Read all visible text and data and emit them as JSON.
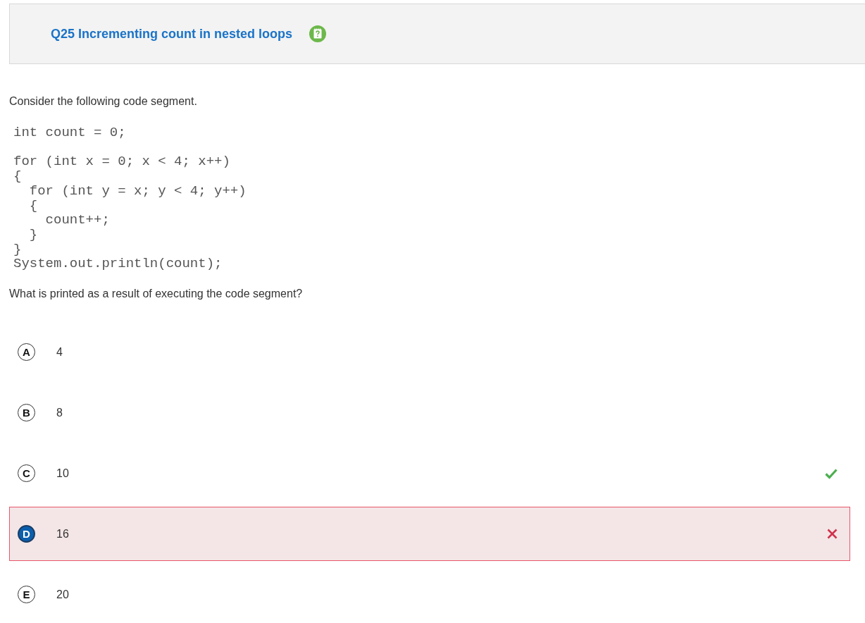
{
  "header": {
    "title": "Q25 Incrementing count in nested loops"
  },
  "prompt": "Consider the following code segment.",
  "code": "int count = 0;\n\nfor (int x = 0; x < 4; x++)\n{\n  for (int y = x; y < 4; y++)\n  {\n    count++;\n  }\n}\nSystem.out.println(count);",
  "question": "What is printed as a result of executing the code segment?",
  "options": [
    {
      "letter": "A",
      "value": "4",
      "selected": false,
      "correct": false
    },
    {
      "letter": "B",
      "value": "8",
      "selected": false,
      "correct": false
    },
    {
      "letter": "C",
      "value": "10",
      "selected": false,
      "correct": true
    },
    {
      "letter": "D",
      "value": "16",
      "selected": true,
      "correct": false
    },
    {
      "letter": "E",
      "value": "20",
      "selected": false,
      "correct": false
    }
  ]
}
